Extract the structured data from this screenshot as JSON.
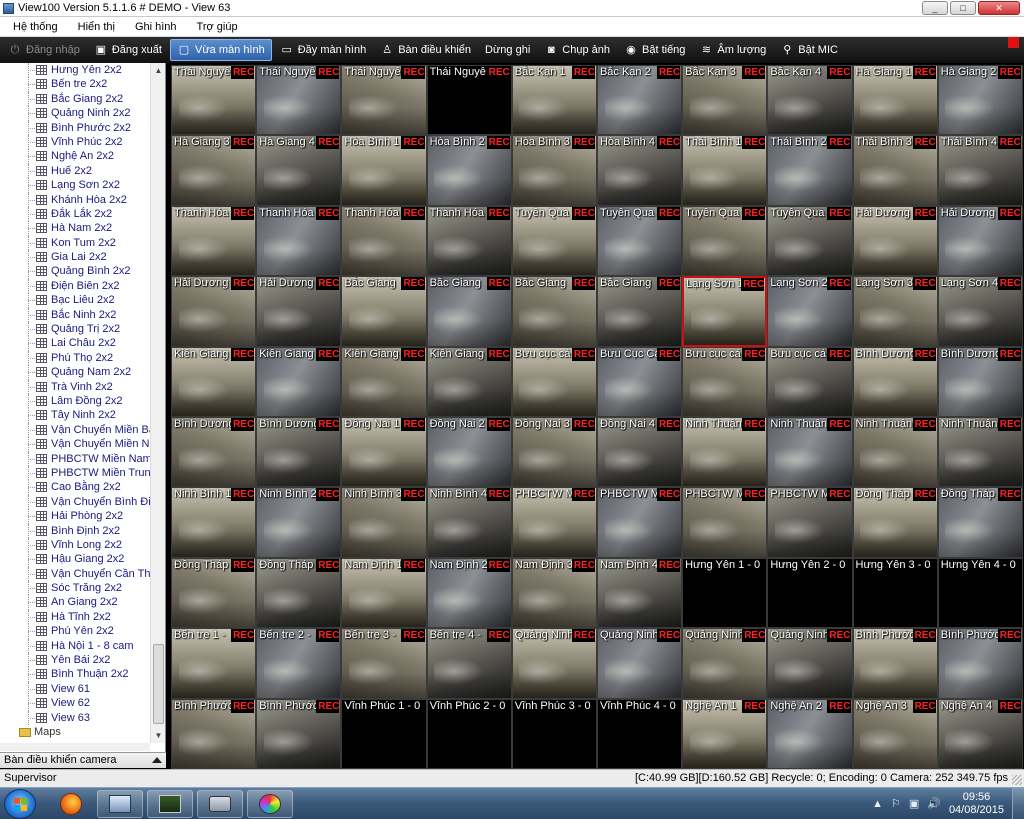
{
  "window": {
    "title": "View100 Version 5.1.1.6 # DEMO - View 63",
    "controls": [
      "_",
      "□",
      "✕"
    ]
  },
  "menu": [
    "Hệ thống",
    "Hiển thị",
    "Ghi hình",
    "Trợ giúp"
  ],
  "toolbar": [
    {
      "label": "Đăng nhập",
      "icon": "login-icon",
      "state": "disabled"
    },
    {
      "label": "Đăng xuất",
      "icon": "logout-icon",
      "state": "normal"
    },
    {
      "label": "Vừa màn hình",
      "icon": "fit-screen-icon",
      "state": "active"
    },
    {
      "label": "Đầy màn hình",
      "icon": "fullscreen-icon",
      "state": "normal"
    },
    {
      "label": "Bàn điều khiển",
      "icon": "joystick-icon",
      "state": "normal"
    },
    {
      "label": "Dừng ghi",
      "icon": "record-stop-icon",
      "state": "normal"
    },
    {
      "label": "Chụp ảnh",
      "icon": "camera-snapshot-icon",
      "state": "normal"
    },
    {
      "label": "Bật tiếng",
      "icon": "speaker-icon",
      "state": "normal"
    },
    {
      "label": "Âm lượng",
      "icon": "volume-icon",
      "state": "normal"
    },
    {
      "label": "Bật MIC",
      "icon": "microphone-icon",
      "state": "normal"
    }
  ],
  "tree": {
    "items": [
      "Hưng Yên 2x2",
      "Bến tre 2x2",
      "Bắc Giang 2x2",
      "Quảng Ninh 2x2",
      "Bình Phước 2x2",
      "Vĩnh Phúc 2x2",
      "Nghệ An 2x2",
      "Huế 2x2",
      "Lạng Sơn 2x2",
      "Khánh Hòa 2x2",
      "Đắk Lắk 2x2",
      "Hà Nam 2x2",
      "Kon Tum 2x2",
      "Gia Lai 2x2",
      "Quảng Bình 2x2",
      "Điện Biên 2x2",
      "Bạc Liêu 2x2",
      "Bắc Ninh 2x2",
      "Quảng Trị 2x2",
      "Lai Châu 2x2",
      "Phú Thọ 2x2",
      "Quảng Nam 2x2",
      "Trà Vinh 2x2",
      "Lâm Đồng 2x2",
      "Tây Ninh 2x2",
      "Vận Chuyển Miền Bắ",
      "Vận Chuyển Miền Na",
      "PHBCTW Miền Nam",
      "PHBCTW Miền Trung",
      "Cao Bằng 2x2",
      "Vận Chuyển Bình Đin",
      "Hải Phòng 2x2",
      "Bình Định 2x2",
      "Vĩnh Long 2x2",
      "Hậu Giang 2x2",
      "Vận Chuyển Cần Tho",
      "Sóc Trăng 2x2",
      "An Giang 2x2",
      "Hà Tĩnh 2x2",
      "Phú Yên 2x2",
      "Hà Nội 1 - 8 cam",
      "Yên Bái 2x2",
      "Bình Thuận 2x2",
      "View 61",
      "View 62",
      "View 63"
    ],
    "maps_label": "Maps"
  },
  "camera_control_label": "Bàn điều khiển camera",
  "grid": {
    "rec_label": "REC",
    "cells": [
      {
        "label": "Thái Nguyê",
        "rec": true,
        "live": true
      },
      {
        "label": "Thái Nguyê",
        "rec": true,
        "live": true
      },
      {
        "label": "Thái Nguyê",
        "rec": true,
        "live": true
      },
      {
        "label": "Thái Nguyê",
        "rec": true,
        "live": false
      },
      {
        "label": "Bắc Kạn 1",
        "rec": true,
        "live": true
      },
      {
        "label": "Bắc Kạn 2",
        "rec": true,
        "live": true
      },
      {
        "label": "Bắc Kạn 3",
        "rec": true,
        "live": true
      },
      {
        "label": "Bắc Kạn 4",
        "rec": true,
        "live": true
      },
      {
        "label": "Hà Giang 1",
        "rec": true,
        "live": true
      },
      {
        "label": "Hà Giang 2",
        "rec": true,
        "live": true
      },
      {
        "label": "Hà Giang 3",
        "rec": true,
        "live": true
      },
      {
        "label": "Hà Giang 4",
        "rec": true,
        "live": true
      },
      {
        "label": "Hòa Bình 1",
        "rec": true,
        "live": true
      },
      {
        "label": "Hòa Bình 2",
        "rec": true,
        "live": true
      },
      {
        "label": "Hòa Bình 3",
        "rec": true,
        "live": true
      },
      {
        "label": "Hòa Bình 4",
        "rec": true,
        "live": true
      },
      {
        "label": "Thái Bình 1",
        "rec": true,
        "live": true
      },
      {
        "label": "Thái Bình 2",
        "rec": true,
        "live": true
      },
      {
        "label": "Thái Bình 3",
        "rec": true,
        "live": true
      },
      {
        "label": "Thái Bình 4",
        "rec": true,
        "live": true
      },
      {
        "label": "Thanh Hóa",
        "rec": true,
        "live": true
      },
      {
        "label": "Thanh Hóa",
        "rec": true,
        "live": true
      },
      {
        "label": "Thanh Hóa",
        "rec": true,
        "live": true
      },
      {
        "label": "Thanh Hóa",
        "rec": true,
        "live": true
      },
      {
        "label": "Tuyên Qua",
        "rec": true,
        "live": true
      },
      {
        "label": "Tuyên Qua",
        "rec": true,
        "live": true
      },
      {
        "label": "Tuyên Qua",
        "rec": true,
        "live": true
      },
      {
        "label": "Tuyên Qua",
        "rec": true,
        "live": true
      },
      {
        "label": "Hải Dương",
        "rec": true,
        "live": true
      },
      {
        "label": "Hải Dương",
        "rec": true,
        "live": true
      },
      {
        "label": "Hải Dương",
        "rec": true,
        "live": true
      },
      {
        "label": "Hải Dương",
        "rec": true,
        "live": true
      },
      {
        "label": "Bắc Giang",
        "rec": true,
        "live": true
      },
      {
        "label": "Bắc Giang",
        "rec": true,
        "live": true
      },
      {
        "label": "Bắc Giang",
        "rec": true,
        "live": true
      },
      {
        "label": "Bắc Giang",
        "rec": true,
        "live": true
      },
      {
        "label": "Lạng Sơn 1",
        "rec": true,
        "live": true,
        "selected": true
      },
      {
        "label": "Lạng Sơn 2",
        "rec": true,
        "live": true
      },
      {
        "label": "Lạng Sơn 3",
        "rec": true,
        "live": true
      },
      {
        "label": "Lạng Sơn 4",
        "rec": true,
        "live": true
      },
      {
        "label": "Kiên Giang",
        "rec": true,
        "live": true
      },
      {
        "label": "Kiên Giang",
        "rec": true,
        "live": true
      },
      {
        "label": "Kiên Giang",
        "rec": true,
        "live": true
      },
      {
        "label": "Kiên Giang",
        "rec": true,
        "live": true
      },
      {
        "label": "Bưu cục cá",
        "rec": true,
        "live": true
      },
      {
        "label": "Bưu Cục Cá",
        "rec": true,
        "live": true
      },
      {
        "label": "Bưu cục cá",
        "rec": true,
        "live": true
      },
      {
        "label": "Bưu cục cá",
        "rec": true,
        "live": true
      },
      {
        "label": "Bình Dương",
        "rec": true,
        "live": true
      },
      {
        "label": "Bình Dương",
        "rec": true,
        "live": true
      },
      {
        "label": "Bình Dương",
        "rec": true,
        "live": true
      },
      {
        "label": "Bình Dương",
        "rec": true,
        "live": true
      },
      {
        "label": "Đồng Nai 1",
        "rec": true,
        "live": true
      },
      {
        "label": "Đồng Nai 2",
        "rec": true,
        "live": true
      },
      {
        "label": "Đồng Nai 3",
        "rec": true,
        "live": true
      },
      {
        "label": "Đồng Nai 4",
        "rec": true,
        "live": true
      },
      {
        "label": "Ninh Thuận",
        "rec": true,
        "live": true
      },
      {
        "label": "Ninh Thuận",
        "rec": true,
        "live": true
      },
      {
        "label": "Ninh Thuận",
        "rec": true,
        "live": true
      },
      {
        "label": "Ninh Thuận",
        "rec": true,
        "live": true
      },
      {
        "label": "Ninh Bình 1",
        "rec": true,
        "live": true
      },
      {
        "label": "Ninh Bình 2",
        "rec": true,
        "live": true
      },
      {
        "label": "Ninh Bình 3",
        "rec": true,
        "live": true
      },
      {
        "label": "Ninh Bình 4",
        "rec": true,
        "live": true
      },
      {
        "label": "PHBCTW M",
        "rec": true,
        "live": true
      },
      {
        "label": "PHBCTW M",
        "rec": true,
        "live": true
      },
      {
        "label": "PHBCTW M",
        "rec": true,
        "live": true
      },
      {
        "label": "PHBCTW M",
        "rec": true,
        "live": true
      },
      {
        "label": "Đồng Tháp",
        "rec": true,
        "live": true
      },
      {
        "label": "Đồng Tháp",
        "rec": true,
        "live": true
      },
      {
        "label": "Đồng Tháp",
        "rec": true,
        "live": true
      },
      {
        "label": "Đồng Tháp",
        "rec": true,
        "live": true
      },
      {
        "label": "Nam Định 1",
        "rec": true,
        "live": true
      },
      {
        "label": "Nam Định 2",
        "rec": true,
        "live": true
      },
      {
        "label": "Nam Định 3",
        "rec": true,
        "live": true
      },
      {
        "label": "Nam Định 4",
        "rec": true,
        "live": true
      },
      {
        "label": "Hưng Yên 1 - 0",
        "rec": false,
        "live": false
      },
      {
        "label": "Hưng Yên 2 - 0",
        "rec": false,
        "live": false
      },
      {
        "label": "Hưng Yên 3 - 0",
        "rec": false,
        "live": false
      },
      {
        "label": "Hưng Yên 4 - 0",
        "rec": false,
        "live": false
      },
      {
        "label": "Bến tre 1 -",
        "rec": true,
        "live": true
      },
      {
        "label": "Bến tre 2 -",
        "rec": true,
        "live": true
      },
      {
        "label": "Bến tre 3 -",
        "rec": true,
        "live": true
      },
      {
        "label": "Bến tre 4 -",
        "rec": true,
        "live": true
      },
      {
        "label": "Quảng Ninh",
        "rec": true,
        "live": true
      },
      {
        "label": "Quảng Ninh",
        "rec": true,
        "live": true
      },
      {
        "label": "Quảng Ninh",
        "rec": true,
        "live": true
      },
      {
        "label": "Quảng Ninh",
        "rec": true,
        "live": true
      },
      {
        "label": "Bình Phước",
        "rec": true,
        "live": true
      },
      {
        "label": "Bình Phước",
        "rec": true,
        "live": true
      },
      {
        "label": "Bình Phước",
        "rec": true,
        "live": true
      },
      {
        "label": "Bình Phước",
        "rec": true,
        "live": true
      },
      {
        "label": "Vĩnh Phúc 1 - 0",
        "rec": false,
        "live": false
      },
      {
        "label": "Vĩnh Phúc 2 - 0",
        "rec": false,
        "live": false
      },
      {
        "label": "Vĩnh Phúc 3 - 0",
        "rec": false,
        "live": false
      },
      {
        "label": "Vĩnh Phúc 4 - 0",
        "rec": false,
        "live": false
      },
      {
        "label": "Nghệ An 1",
        "rec": true,
        "live": true
      },
      {
        "label": "Nghệ An 2",
        "rec": true,
        "live": true
      },
      {
        "label": "Nghệ An 3",
        "rec": true,
        "live": true
      },
      {
        "label": "Nghệ An 4",
        "rec": true,
        "live": true
      }
    ]
  },
  "status": {
    "user": "Supervisor",
    "disk": "[C:40.99 GB][D:160.52 GB]",
    "recycle": "Recycle: 0;",
    "encoding": "Encoding: 0",
    "camera": "Camera: 252",
    "fps": "349.75 fps"
  },
  "taskbar": {
    "apps": [
      "firefox-icon",
      "computer-icon",
      "terminal-icon",
      "camera-app-icon",
      "paint-icon"
    ],
    "tray_icons": [
      "▲",
      "⚐",
      "▣",
      "🔊"
    ],
    "time": "09:56",
    "date": "04/08/2015"
  },
  "colors": {
    "rec": "#ff2020",
    "toolbar_bg": "#1a1a1a",
    "active_tab": "#3c72bc",
    "selected_border": "#d01010"
  }
}
